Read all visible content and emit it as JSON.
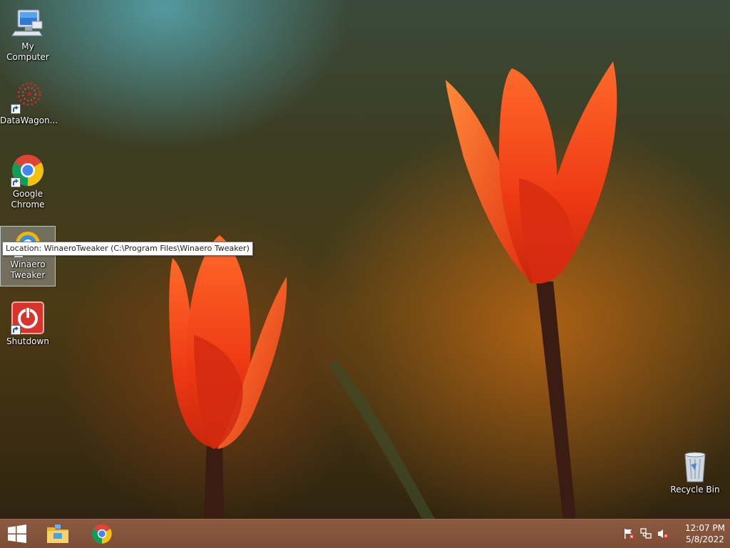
{
  "desktop": {
    "icons": [
      {
        "label": "My Computer"
      },
      {
        "label": "DataWagon..."
      },
      {
        "label": "Google Chrome"
      },
      {
        "label": "Winaero Tweaker"
      },
      {
        "label": "Shutdown"
      },
      {
        "label": "Recycle Bin"
      }
    ],
    "tooltip": "Location: WinaeroTweaker (C:\\Program Files\\Winaero Tweaker)"
  },
  "taskbar": {
    "start_icon": "windows-logo-icon",
    "pinned": [
      {
        "name": "file-explorer-icon"
      },
      {
        "name": "chrome-icon"
      }
    ],
    "tray": [
      "action-center-flag-icon",
      "network-icon",
      "volume-muted-icon"
    ],
    "clock": {
      "time": "12:07 PM",
      "date": "5/8/2022"
    }
  },
  "colors": {
    "taskbar": "#7d4e36",
    "tulip": "#f0401a",
    "selection": "#c8d2dc"
  }
}
